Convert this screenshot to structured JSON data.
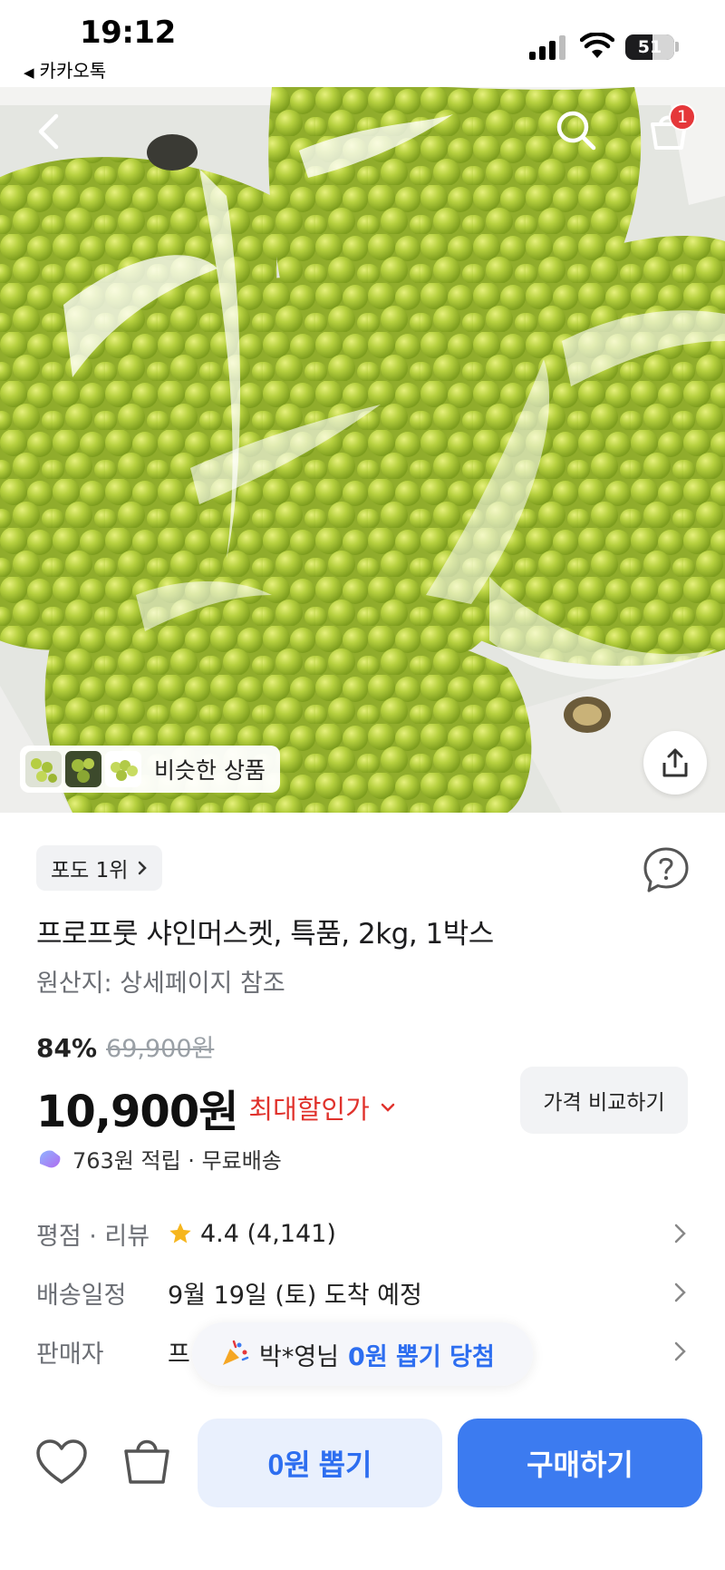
{
  "status_bar": {
    "time": "19:12",
    "back_app": "카카오톡",
    "battery": "51"
  },
  "product": {
    "rank_badge": "포도 1위",
    "title": "프로프룻 샤인머스켓, 특품, 2kg, 1박스",
    "origin": "원산지: 상세페이지 참조",
    "discount_rate": "84%",
    "original_price": "69,900원",
    "price": "10,900원",
    "max_discount_label": "최대할인가",
    "compare_button": "가격 비교하기",
    "reward_text": "763원 적립 · 무료배송"
  },
  "image": {
    "similar_label": "비슷한 상품",
    "cart_badge_count": "1"
  },
  "info_rows": [
    {
      "label": "평점 · 리뷰",
      "value": "4.4 (4,141)"
    },
    {
      "label": "배송일정",
      "value": "9월 19일 (토) 도착 예정"
    },
    {
      "label": "판매자",
      "value": "프"
    }
  ],
  "toast": {
    "name": "박*영님",
    "message": "0원 뽑기 당첨"
  },
  "bottom_bar": {
    "draw_button": "0원 뽑기",
    "buy_button": "구매하기"
  },
  "colors": {
    "primary_blue": "#3c7bf0",
    "discount_red": "#e0322c",
    "grape_green": "#a9c93a"
  }
}
